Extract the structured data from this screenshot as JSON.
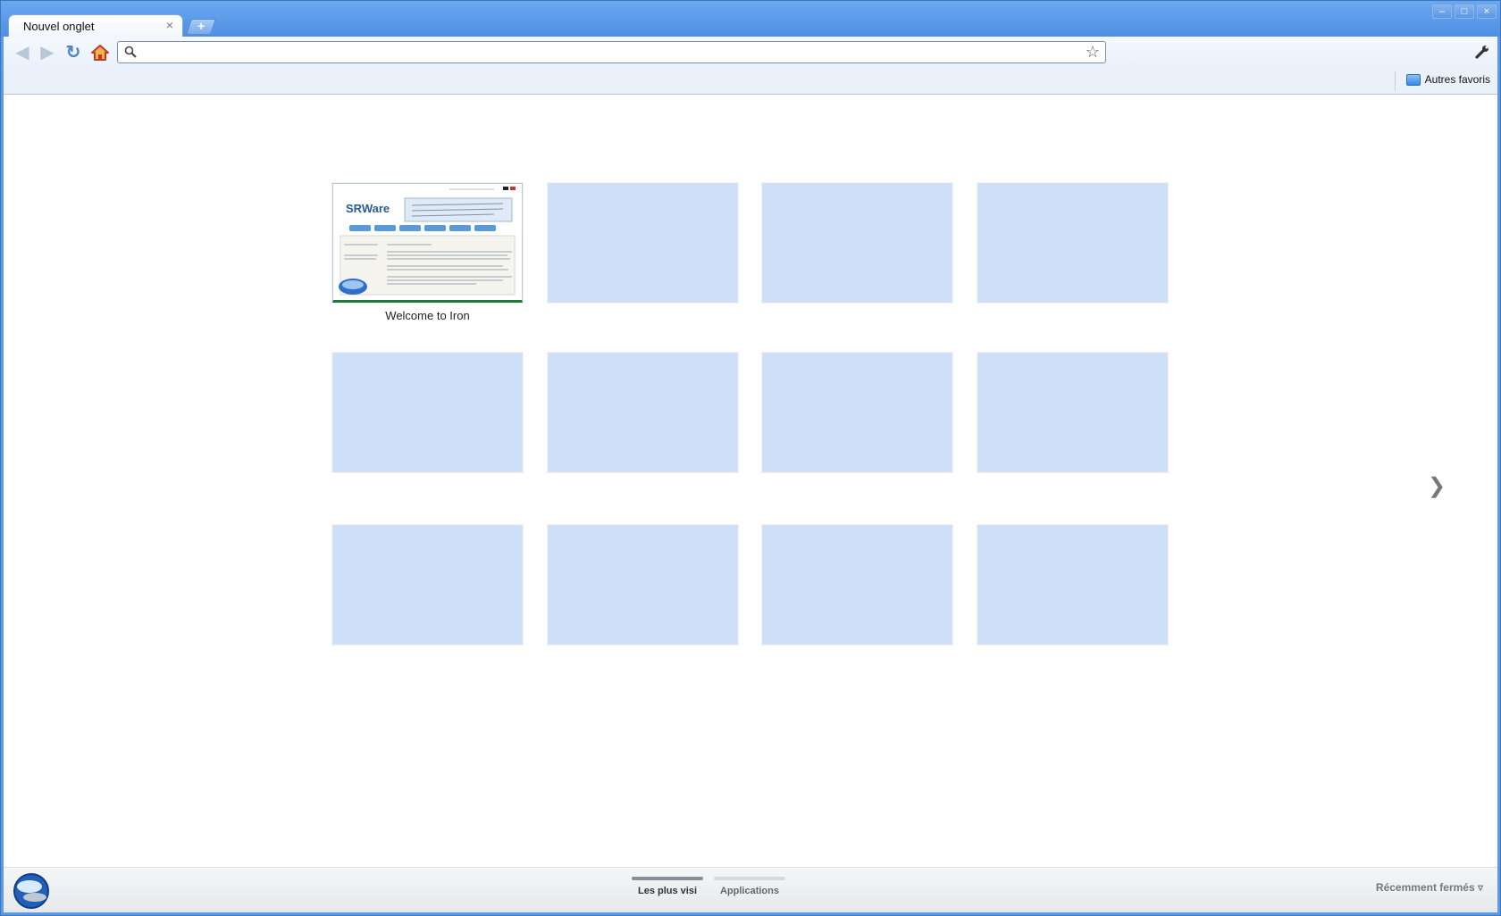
{
  "tab": {
    "title": "Nouvel onglet",
    "close": "×",
    "new_tab": "+"
  },
  "window_controls": {
    "minimize": "–",
    "maximize": "□",
    "close": "×"
  },
  "omnibox": {
    "value": "",
    "star": "☆"
  },
  "nav": {
    "back": "◀",
    "forward": "▶",
    "reload": "↻"
  },
  "bookmarks": {
    "other": "Autres favoris"
  },
  "thumbnail": {
    "logo_text": "SRWare",
    "label": "Welcome to Iron"
  },
  "pager": {
    "next": "❯"
  },
  "footer": {
    "sections": [
      {
        "label": "Les plus visi",
        "active": true
      },
      {
        "label": "Applications",
        "active": false
      }
    ],
    "recently_closed": "Récemment fermés ▿"
  },
  "colors": {
    "tile_empty": "#cde0f7",
    "active_bar": "#8a8f95",
    "inactive_bar": "#d6d9dc"
  }
}
